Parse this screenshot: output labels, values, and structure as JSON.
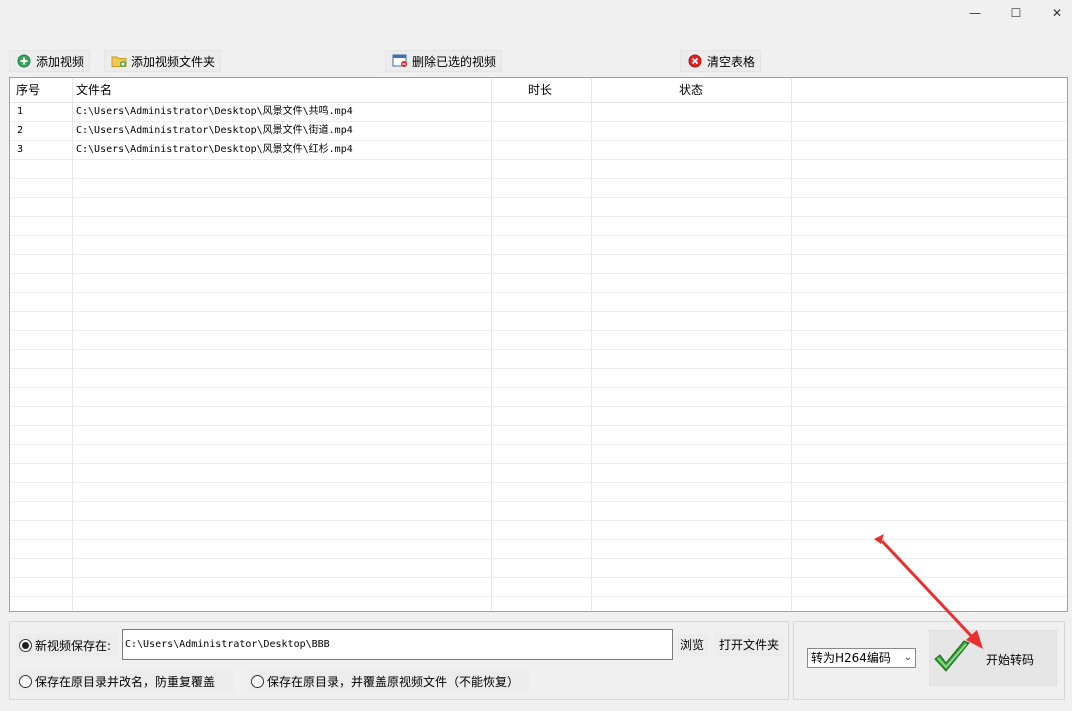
{
  "window": {
    "minimize": "—",
    "maximize": "☐",
    "close": "✕"
  },
  "toolbar": {
    "add_video": "添加视频",
    "add_folder": "添加视频文件夹",
    "delete_selected": "删除已选的视频",
    "clear_table": "清空表格"
  },
  "table": {
    "columns": [
      "序号",
      "文件名",
      "时长",
      "状态"
    ],
    "rows": [
      {
        "index": "1",
        "filename": "C:\\Users\\Administrator\\Desktop\\风景文件\\共鸣.mp4",
        "duration": "",
        "status": ""
      },
      {
        "index": "2",
        "filename": "C:\\Users\\Administrator\\Desktop\\风景文件\\街道.mp4",
        "duration": "",
        "status": ""
      },
      {
        "index": "3",
        "filename": "C:\\Users\\Administrator\\Desktop\\风景文件\\红杉.mp4",
        "duration": "",
        "status": ""
      }
    ]
  },
  "output": {
    "new_save_label": "新视频保存在:",
    "new_save_selected": true,
    "path": "C:\\Users\\Administrator\\Desktop\\BBB",
    "browse": "浏览",
    "open_folder": "打开文件夹",
    "rename_option": "保存在原目录并改名，防重复覆盖",
    "overwrite_option": "保存在原目录，并覆盖原视频文件（不能恢复）"
  },
  "convert": {
    "format_selected": "转为H264编码",
    "start": "开始转码"
  },
  "colors": {
    "annotation_arrow": "#e8312f",
    "check_green": "#2e9e2e",
    "clear_red": "#e02424",
    "add_green": "#3aa55a"
  }
}
